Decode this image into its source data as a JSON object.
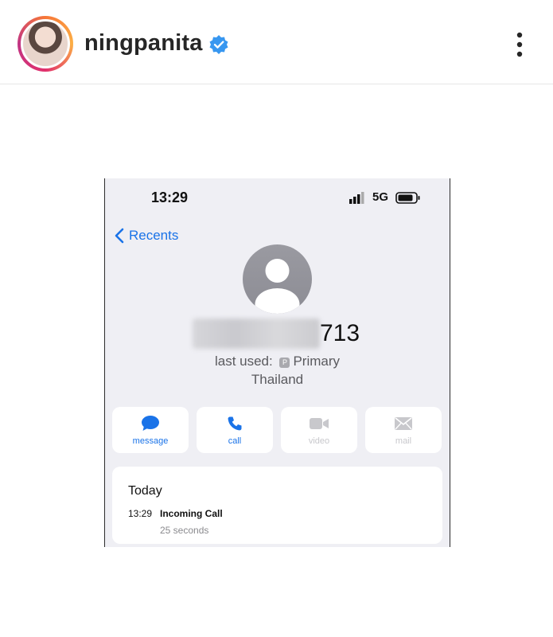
{
  "header": {
    "username": "ningpanita",
    "verified": true,
    "icons": [
      "avatar",
      "verified-badge-icon",
      "more-options-icon"
    ]
  },
  "phone": {
    "status_time": "13:29",
    "network": "5G",
    "back_label": "Recents",
    "number_suffix": "713",
    "last_used_prefix": "last used:",
    "sim_letter": "P",
    "sim_name": "Primary",
    "country": "Thailand",
    "actions": [
      {
        "label": "message",
        "icon": "message-bubble-icon",
        "enabled": true
      },
      {
        "label": "call",
        "icon": "phone-icon",
        "enabled": true
      },
      {
        "label": "video",
        "icon": "video-camera-icon",
        "enabled": false
      },
      {
        "label": "mail",
        "icon": "envelope-icon",
        "enabled": false
      }
    ],
    "history": {
      "day": "Today",
      "entries": [
        {
          "time": "13:29",
          "type": "Incoming Call",
          "duration": "25 seconds"
        }
      ]
    }
  },
  "colors": {
    "accent": "#1a73e8",
    "verified": "#3897f0",
    "screen_bg": "#efeff4",
    "disabled": "#c8c8cc"
  }
}
